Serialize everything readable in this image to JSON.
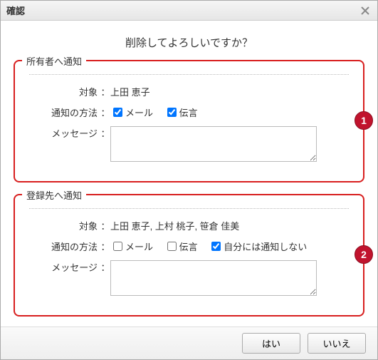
{
  "window": {
    "title": "確認"
  },
  "question": "削除してよろしいですか？",
  "labels": {
    "target": "対象",
    "method": "通知の方法",
    "message": "メッセージ",
    "mail": "メール",
    "memo": "伝言",
    "exclude_self": "自分には通知しない"
  },
  "group1": {
    "legend": "所有者へ通知",
    "target": "上田 恵子",
    "mail_checked": true,
    "memo_checked": true,
    "message": ""
  },
  "group2": {
    "legend": "登録先へ通知",
    "target": "上田 恵子, 上村 桃子, 笹倉 佳美",
    "mail_checked": false,
    "memo_checked": false,
    "exclude_self_checked": true,
    "message": ""
  },
  "footer": {
    "yes": "はい",
    "no": "いいえ"
  },
  "badges": {
    "one": "1",
    "two": "2"
  }
}
